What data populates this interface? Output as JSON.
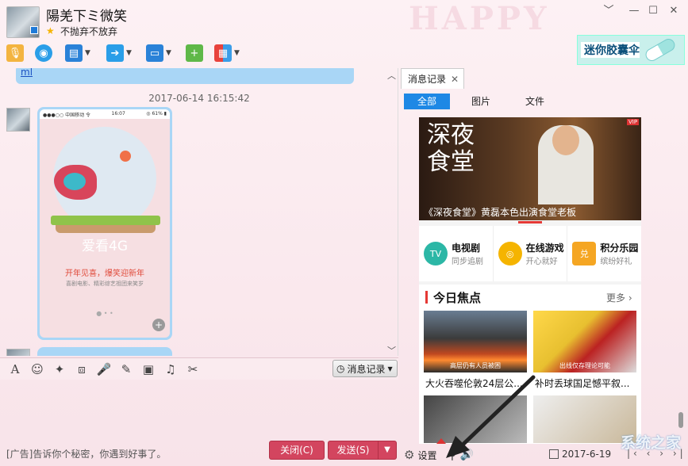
{
  "window": {
    "contact_name": "陽羌下ミ微笑",
    "signature": "不抛弃不放弃"
  },
  "header_ad": {
    "text": "迷你胶囊伞"
  },
  "bg_text": "HAPPY",
  "toolbar": {
    "icons": [
      "microphone-icon",
      "video-call-icon",
      "screen-share-icon",
      "file-transfer-icon",
      "remote-desktop-icon",
      "invite-icon",
      "apps-icon"
    ]
  },
  "chat": {
    "prev_link": "ml",
    "timestamp": "2017-06-14 16:15:42",
    "phone_status_left": "●●●○○ 中国移动 令",
    "phone_status_time": "16:07",
    "phone_status_right": "◎ 61% ▮",
    "love4g": "爱看4G",
    "promo_title": "开年见喜，爆笑迎新年",
    "promo_sub": "喜剧电影、精彩综艺祖团来笑岁",
    "dots": "● • •"
  },
  "input": {
    "history_label": "消息记录",
    "ad_text": "[广告]告诉你个秘密，你遇到好事了。",
    "close_label": "关闭(C)",
    "send_label": "发送(S)"
  },
  "side": {
    "tab_label": "消息记录",
    "filters": [
      "全部",
      "图片",
      "文件"
    ],
    "banner_art": "深夜食堂",
    "banner_caption": "《深夜食堂》黄磊本色出演食堂老板",
    "vip": "VIP",
    "categories": [
      {
        "title": "电视剧",
        "sub": "同步追剧",
        "color": "#2cb7a6",
        "icon": "TV"
      },
      {
        "title": "在线游戏",
        "sub": "开心就好",
        "color": "#f5b400",
        "icon": "◎"
      },
      {
        "title": "积分乐园",
        "sub": "缤纷好礼",
        "color": "#f5a623",
        "icon": "兑"
      }
    ],
    "focus_title": "今日焦点",
    "focus_more": "更多",
    "news": [
      {
        "tag": "高层仍有人员被困",
        "title": "大火吞噬伦敦24层公..."
      },
      {
        "tag": "出线仅存理论可能",
        "title": "补时丢球国足憾平叙..."
      }
    ],
    "settings_label": "设置",
    "date": "2017-6-19",
    "watermark": "系统之家"
  }
}
